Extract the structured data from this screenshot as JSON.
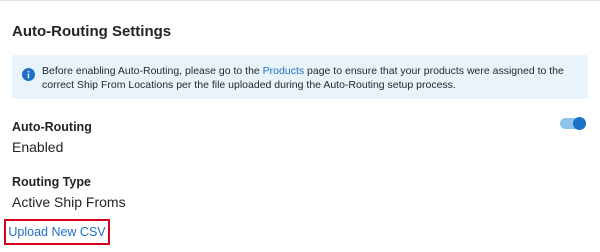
{
  "card": {
    "title": "Auto-Routing Settings"
  },
  "info_banner": {
    "icon": "info-icon",
    "text_before": "Before enabling Auto-Routing, please go to the ",
    "link_text": "Products",
    "text_after": " page to ensure that your products were assigned to the correct Ship From Locations per the file uploaded during the Auto-Routing setup process.",
    "background": "#e8f3fa",
    "icon_color": "#1f6fc4"
  },
  "auto_routing": {
    "label": "Auto-Routing",
    "value": "Enabled",
    "toggle_on": true,
    "toggle_color": "#1a73c8"
  },
  "routing_type": {
    "label": "Routing Type",
    "value": "Active Ship Froms"
  },
  "upload": {
    "link_text": "Upload New CSV",
    "highlight_color": "#d9001b"
  },
  "colors": {
    "link": "#1f6fc4",
    "text": "#212529"
  }
}
